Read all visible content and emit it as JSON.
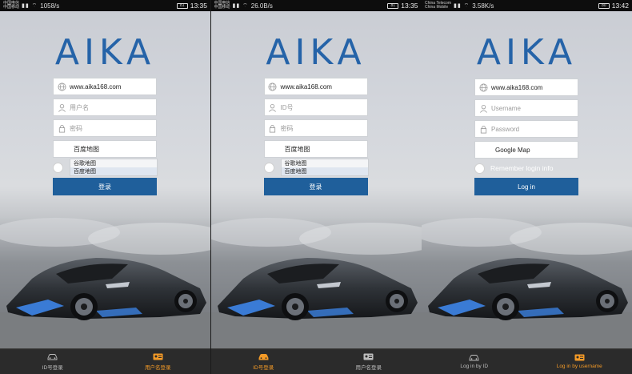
{
  "screens": [
    {
      "status": {
        "carrier1": "中国电信",
        "carrier2": "中国移动",
        "speed": "1058/s",
        "time": "13:35",
        "battery": "81"
      },
      "logo": "AIKA",
      "url": "www.aika168.com",
      "user_placeholder": "用户名",
      "password_placeholder": "密码",
      "map_value": "百度地图",
      "map_options": [
        "谷歌地图",
        "百度地图"
      ],
      "remember_label": "",
      "login_label": "登录",
      "tabs": [
        {
          "label": "ID号登录",
          "icon": "car-icon"
        },
        {
          "label": "用户名登录",
          "icon": "id-card-icon"
        }
      ],
      "active_tab": 1
    },
    {
      "status": {
        "carrier1": "中国电信",
        "carrier2": "中国移动",
        "speed": "26.0B/s",
        "time": "13:35",
        "battery": "81"
      },
      "logo": "AIKA",
      "url": "www.aika168.com",
      "user_placeholder": "ID号",
      "password_placeholder": "密码",
      "map_value": "百度地图",
      "map_options": [
        "谷歌地图",
        "百度地图"
      ],
      "remember_label": "",
      "login_label": "登录",
      "tabs": [
        {
          "label": "ID号登录",
          "icon": "car-icon"
        },
        {
          "label": "用户名登录",
          "icon": "id-card-icon"
        }
      ],
      "active_tab": 0
    },
    {
      "status": {
        "carrier1": "China Telecom",
        "carrier2": "China Mobile",
        "speed": "3.58K/s",
        "time": "13:42",
        "battery": "80"
      },
      "logo": "AIKA",
      "url": "www.aika168.com",
      "user_placeholder": "Username",
      "password_placeholder": "Password",
      "map_value": "Google Map",
      "map_options": [],
      "remember_label": "Remember login info",
      "login_label": "Log in",
      "tabs": [
        {
          "label": "Log in by ID",
          "icon": "car-icon"
        },
        {
          "label": "Log in by username",
          "icon": "id-card-icon"
        }
      ],
      "active_tab": 1
    }
  ],
  "colors": {
    "brand": "#2563a8",
    "button": "#1f5f9b",
    "active_tab": "#f39a27",
    "tabbar": "#2b2b2b"
  }
}
